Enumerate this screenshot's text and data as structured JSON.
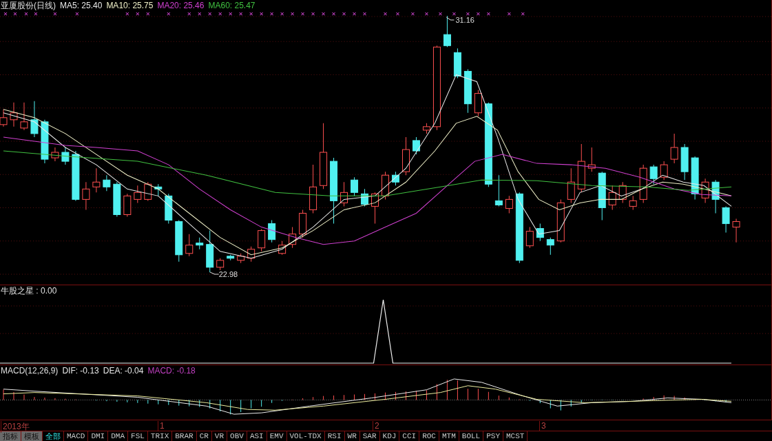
{
  "header": {
    "title": "亚厦股份(日线)",
    "readings": [
      {
        "label": "MA5: 25.40",
        "color": "#e8e8e8"
      },
      {
        "label": "MA10: 25.75",
        "color": "#f0f0c8"
      },
      {
        "label": "MA20: 25.46",
        "color": "#d040d0"
      },
      {
        "label": "MA60: 25.47",
        "color": "#40c040"
      }
    ]
  },
  "price_chart": {
    "high_label": "31.16",
    "low_label": "22.98"
  },
  "signal_panel": {
    "title": "牛股之星 : 0.00"
  },
  "macd_panel": {
    "title": "MACD(12,26,9)",
    "readings": [
      {
        "label": "DIF: -0.13",
        "color": "#e8e8e8"
      },
      {
        "label": "DEA: -0.04",
        "color": "#e8e8e8"
      },
      {
        "label": "MACD: -0.18",
        "color": "#c040c0"
      }
    ]
  },
  "date_axis": [
    "2013年",
    "1",
    "2",
    "3"
  ],
  "tabs": [
    {
      "label": "指标",
      "kind": "menu",
      "selected": false
    },
    {
      "label": "模板",
      "kind": "menu",
      "selected": false
    },
    {
      "label": "全部",
      "kind": "tab",
      "selected": true
    },
    {
      "label": "MACD",
      "kind": "tab",
      "selected": false
    },
    {
      "label": "DMI",
      "kind": "tab",
      "selected": false
    },
    {
      "label": "DMA",
      "kind": "tab",
      "selected": false
    },
    {
      "label": "FSL",
      "kind": "tab",
      "selected": false
    },
    {
      "label": "TRIX",
      "kind": "tab",
      "selected": false
    },
    {
      "label": "BRAR",
      "kind": "tab",
      "selected": false
    },
    {
      "label": "CR",
      "kind": "tab",
      "selected": false
    },
    {
      "label": "VR",
      "kind": "tab",
      "selected": false
    },
    {
      "label": "OBV",
      "kind": "tab",
      "selected": false
    },
    {
      "label": "ASI",
      "kind": "tab",
      "selected": false
    },
    {
      "label": "EMV",
      "kind": "tab",
      "selected": false
    },
    {
      "label": "VOL-TDX",
      "kind": "tab",
      "selected": false
    },
    {
      "label": "RSI",
      "kind": "tab",
      "selected": false
    },
    {
      "label": "WR",
      "kind": "tab",
      "selected": false
    },
    {
      "label": "SAR",
      "kind": "tab",
      "selected": false
    },
    {
      "label": "KDJ",
      "kind": "tab",
      "selected": false
    },
    {
      "label": "CCI",
      "kind": "tab",
      "selected": false
    },
    {
      "label": "ROC",
      "kind": "tab",
      "selected": false
    },
    {
      "label": "MTM",
      "kind": "tab",
      "selected": false
    },
    {
      "label": "BOLL",
      "kind": "tab",
      "selected": false
    },
    {
      "label": "PSY",
      "kind": "tab",
      "selected": false
    },
    {
      "label": "MCST",
      "kind": "tab",
      "selected": false
    }
  ]
}
